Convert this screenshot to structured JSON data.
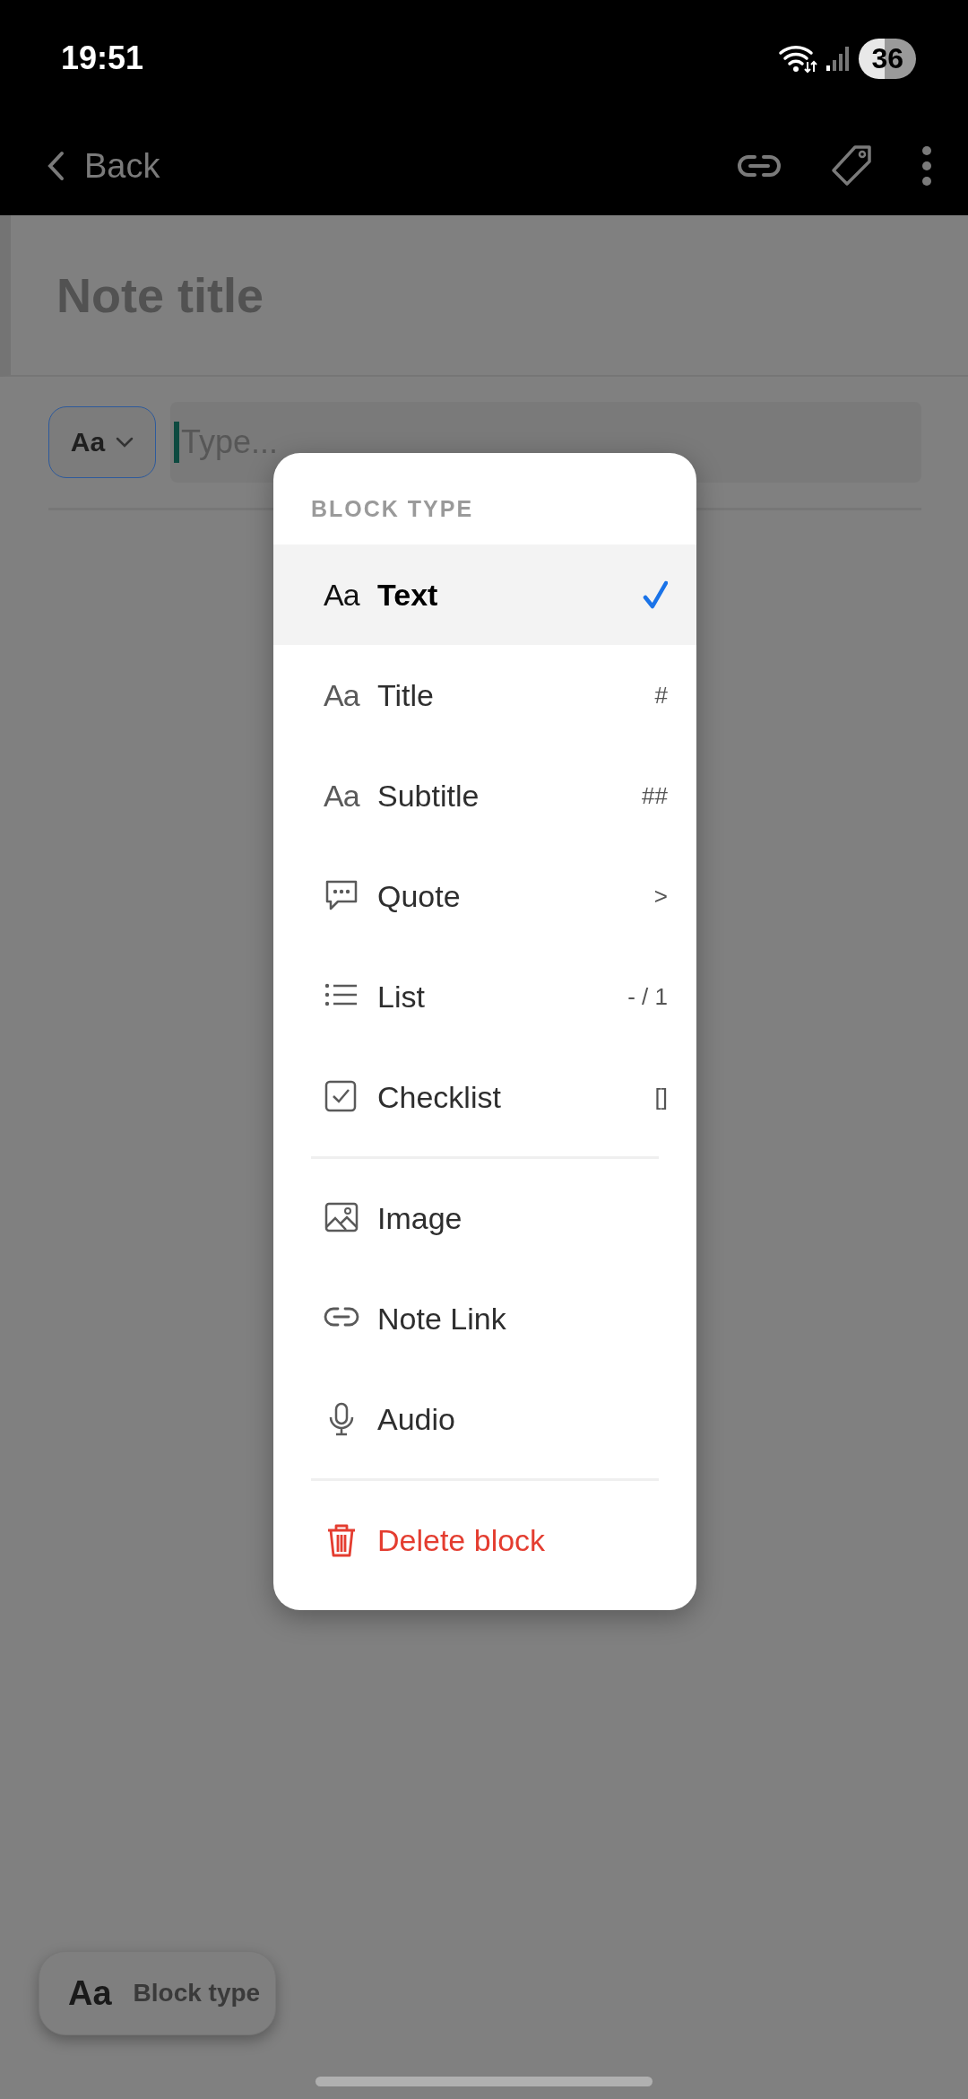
{
  "status_bar": {
    "time": "19:51",
    "battery": "36"
  },
  "app_bar": {
    "back": "Back"
  },
  "note": {
    "title": "Note title",
    "block_button": "Aa",
    "editor": {
      "placeholder": "Type..."
    }
  },
  "menu": {
    "header": "BLOCK TYPE",
    "sections": [
      [
        {
          "kind": "glyph",
          "glyph": "Aa",
          "label": "Text",
          "selected": true
        },
        {
          "kind": "glyph",
          "glyph": "Aa",
          "label": "Title",
          "shortcut": "#",
          "selected": false
        },
        {
          "kind": "glyph",
          "glyph": "Aa",
          "label": "Subtitle",
          "shortcut": "##",
          "selected": false
        },
        {
          "kind": "quote",
          "label": "Quote",
          "shortcut": ">",
          "selected": false
        },
        {
          "kind": "list",
          "label": "List",
          "shortcut": "- / 1",
          "selected": false
        },
        {
          "kind": "checklist",
          "label": "Checklist",
          "shortcut": "[]",
          "selected": false
        }
      ],
      [
        {
          "kind": "image",
          "label": "Image",
          "selected": false
        },
        {
          "kind": "link",
          "label": "Note Link",
          "selected": false
        },
        {
          "kind": "audio",
          "label": "Audio",
          "selected": false
        }
      ],
      [
        {
          "kind": "delete",
          "label": "Delete block",
          "selected": false
        }
      ]
    ]
  },
  "bottom_pill": {
    "glyph": "Aa",
    "label": "Block type"
  }
}
